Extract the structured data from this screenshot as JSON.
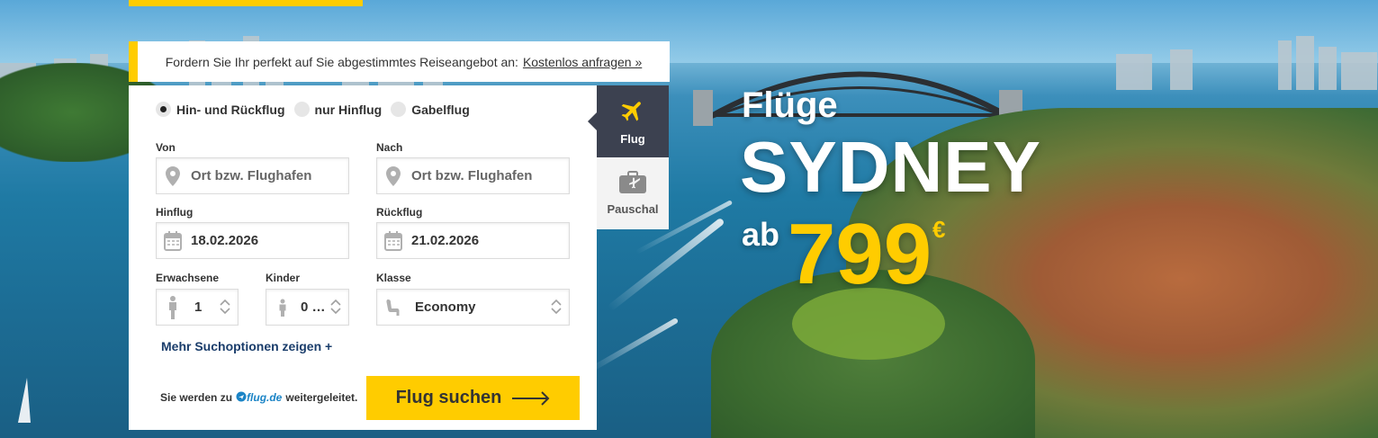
{
  "banner": {
    "text": "Fordern Sie Ihr perfekt auf Sie abgestimmtes Reiseangebot an:",
    "link": "Kostenlos anfragen »"
  },
  "trip_types": [
    {
      "label": "Hin- und Rückflug",
      "checked": true
    },
    {
      "label": "nur Hinflug",
      "checked": false
    },
    {
      "label": "Gabelflug",
      "checked": false
    }
  ],
  "form": {
    "from_label": "Von",
    "from_placeholder": "Ort bzw. Flughafen",
    "to_label": "Nach",
    "to_placeholder": "Ort bzw. Flughafen",
    "depart_label": "Hinflug",
    "depart_value": "18.02.2026",
    "return_label": "Rückflug",
    "return_value": "21.02.2026",
    "adults_label": "Erwachsene",
    "adults_value": "1",
    "children_label": "Kinder",
    "children_value": "0 …",
    "class_label": "Klasse",
    "class_value": "Economy"
  },
  "more_options": "Mehr Suchoptionen zeigen +",
  "redirect": {
    "prefix": "Sie werden zu",
    "brand": "flug.de",
    "suffix": "weitergeleitet."
  },
  "search_button": "Flug suchen",
  "tabs": {
    "flug": "Flug",
    "pauschal": "Pauschal"
  },
  "promo": {
    "title": "Flüge",
    "city": "SYDNEY",
    "ab": "ab",
    "price": "799",
    "currency": "€"
  },
  "colors": {
    "accent": "#ffcc00",
    "tab_active": "#3c4150",
    "link": "#1a3d6b"
  }
}
